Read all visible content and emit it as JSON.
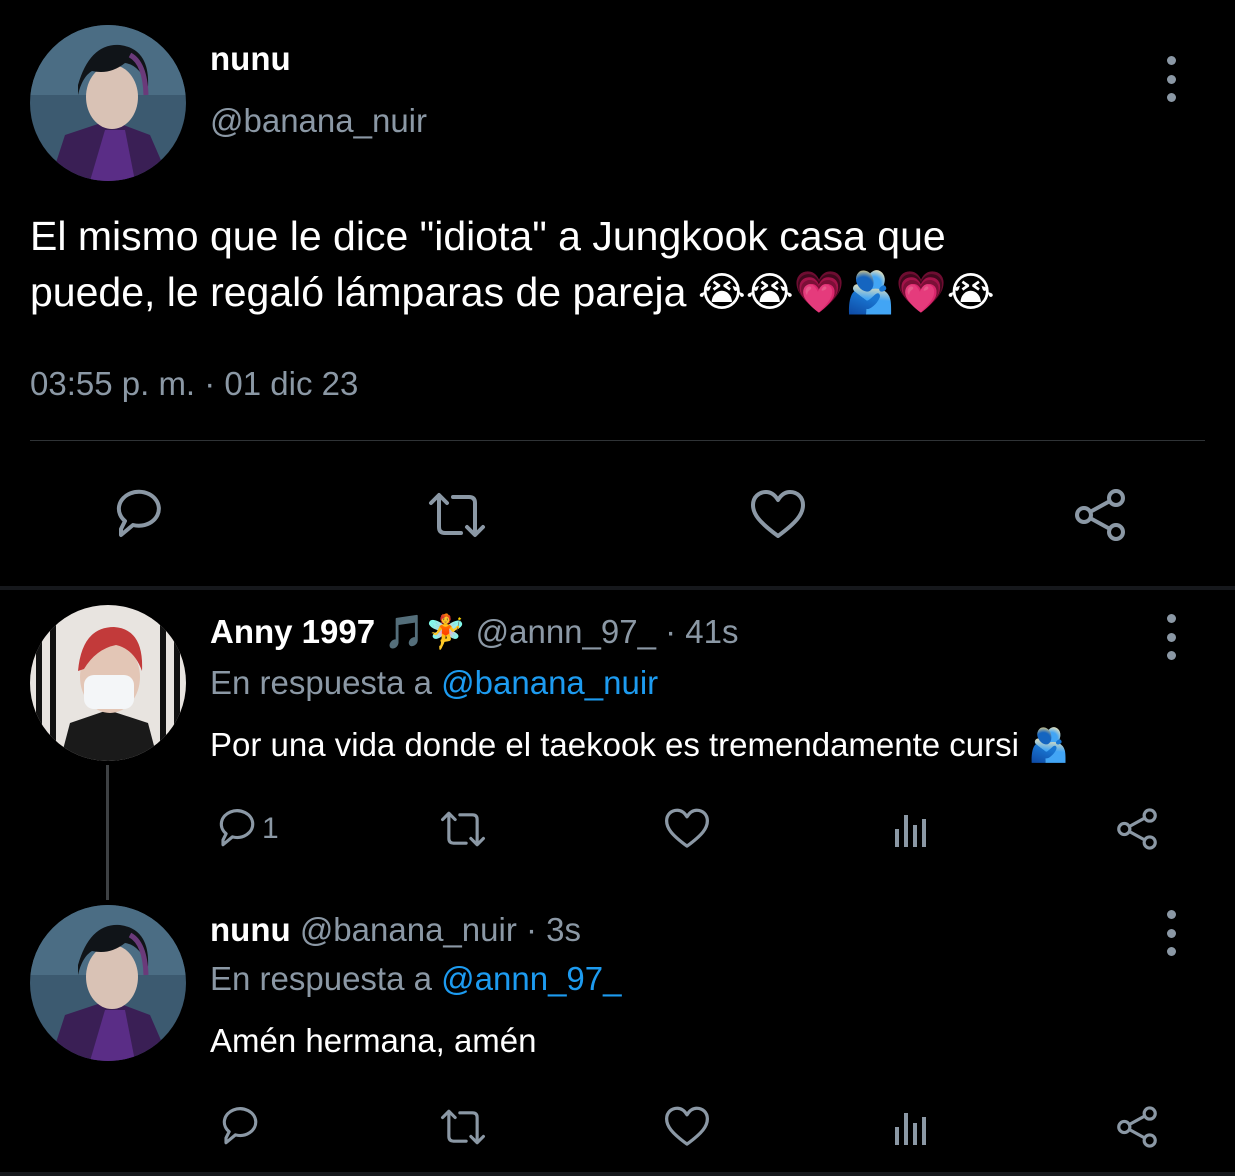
{
  "main_tweet": {
    "author_name": "nunu",
    "handle": "@banana_nuir",
    "text_line1": "El mismo que le dice \"idiota\" a Jungkook casa que",
    "text_line2": "puede, le regaló lámparas de pareja 😭😭💗🫂💗😭",
    "timestamp": "03:55 p. m. · 01 dic 23",
    "actions": [
      "reply-icon",
      "retweet-icon",
      "like-icon",
      "share-icon"
    ]
  },
  "reply1": {
    "author_name": "Anny 1997 🎵🧚",
    "handle": "@annn_97_",
    "time": "· 41s",
    "replying_prefix": "En respuesta a",
    "replying_to": "@banana_nuir",
    "text": "Por una vida donde el taekook es tremendamente cursi 🫂",
    "reply_count": "1"
  },
  "reply2": {
    "author_name": "nunu",
    "handle": "@banana_nuir",
    "time": "· 3s",
    "replying_prefix": "En respuesta a",
    "replying_to": "@annn_97_",
    "text": "Amén hermana, amén"
  },
  "colors": {
    "background": "#000000",
    "text": "#ffffff",
    "muted": "#8b98a5",
    "link": "#1d9bf0",
    "divider": "#2f3336"
  }
}
